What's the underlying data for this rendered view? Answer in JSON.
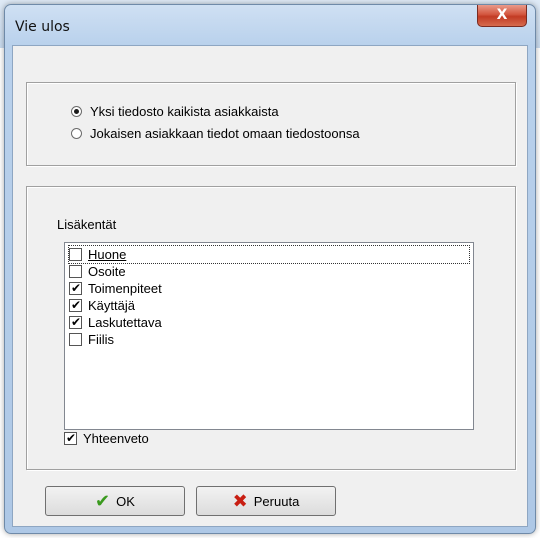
{
  "window": {
    "title": "Vie ulos",
    "close_label": "X"
  },
  "export_mode": {
    "options": [
      {
        "label": "Yksi tiedosto kaikista asiakkaista",
        "selected": true
      },
      {
        "label": "Jokaisen asiakkaan tiedot omaan tiedostoonsa",
        "selected": false
      }
    ]
  },
  "extra_fields": {
    "label": "Lisäkentät",
    "items": [
      {
        "label": "Huone",
        "checked": false
      },
      {
        "label": "Osoite",
        "checked": false
      },
      {
        "label": "Toimenpiteet",
        "checked": true
      },
      {
        "label": "Käyttäjä",
        "checked": true
      },
      {
        "label": "Laskutettava",
        "checked": true
      },
      {
        "label": "Fiilis",
        "checked": false
      }
    ]
  },
  "summary": {
    "label": "Yhteenveto",
    "checked": true
  },
  "buttons": {
    "ok_label": "OK",
    "cancel_label": "Peruuta"
  },
  "colors": {
    "ok_icon": "#3a9a1e",
    "cancel_icon": "#c81e12"
  },
  "icons": {
    "ok": "checkmark-icon",
    "cancel": "cross-icon"
  }
}
